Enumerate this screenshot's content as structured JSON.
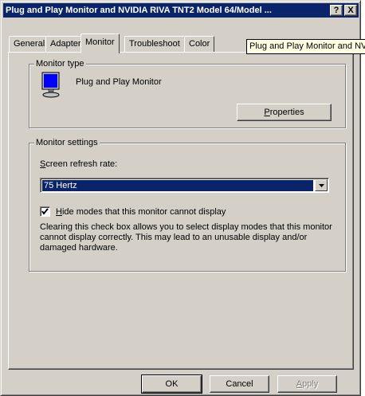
{
  "window": {
    "title": "Plug and Play Monitor and NVIDIA RIVA TNT2 Model 64/Model ...",
    "help_button": "?",
    "close_button": "X"
  },
  "tabs": [
    {
      "label": "General",
      "active": false
    },
    {
      "label": "Adapter",
      "active": false
    },
    {
      "label": "Monitor",
      "active": true
    },
    {
      "label": "Troubleshoot",
      "active": false
    },
    {
      "label": "Color",
      "active": false
    }
  ],
  "tooltip": "Plug and Play Monitor and NVIDIA",
  "monitor_type": {
    "group_label": "Monitor type",
    "monitor_name": "Plug and Play Monitor",
    "properties_button": {
      "prefix": "",
      "underline": "P",
      "rest": "roperties"
    }
  },
  "monitor_settings": {
    "group_label": "Monitor settings",
    "refresh_label": {
      "prefix": "",
      "underline": "S",
      "rest": "creen refresh rate:"
    },
    "refresh_value": "75 Hertz",
    "hide_modes_checkbox": {
      "checked": true,
      "underline": "H",
      "rest": "ide modes that this monitor cannot display"
    },
    "description": "Clearing this check box allows you to select display modes that this monitor cannot display correctly. This may lead to an unusable display and/or damaged hardware."
  },
  "footer": {
    "ok": "OK",
    "cancel": "Cancel",
    "apply": {
      "underline": "A",
      "rest": "pply",
      "disabled": true
    }
  },
  "colors": {
    "title_bar": "#0a246a",
    "face": "#d4d0c8",
    "tooltip_bg": "#ffffe1",
    "selection": "#0a246a"
  }
}
